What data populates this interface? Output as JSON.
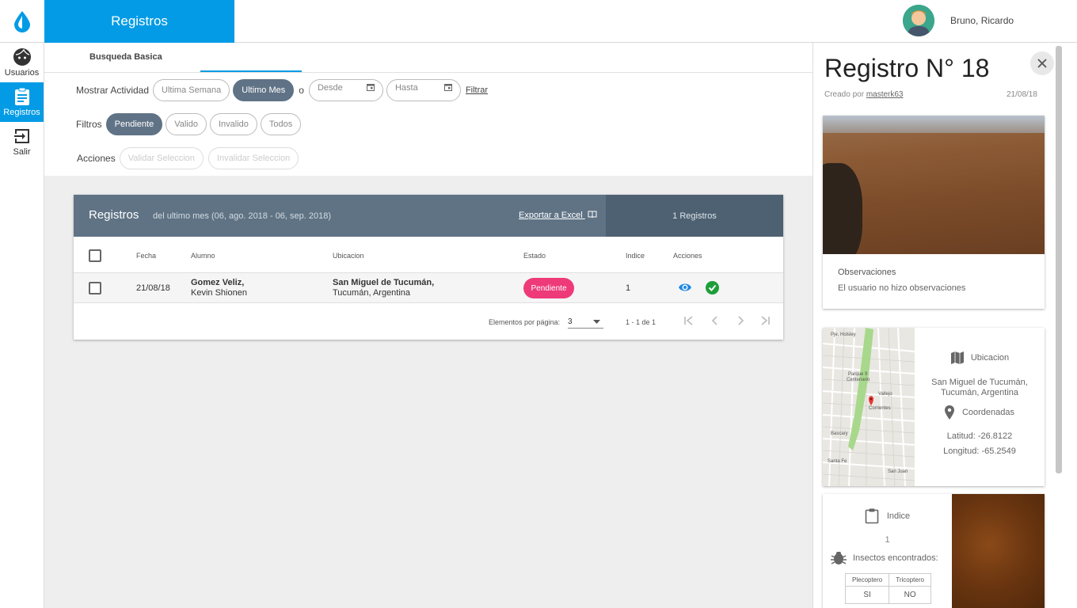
{
  "header": {
    "title": "Registros",
    "user_name": "Bruno, Ricardo"
  },
  "sidebar": {
    "items": [
      {
        "label": "Usuarios",
        "icon": "face-icon"
      },
      {
        "label": "Registros",
        "icon": "clipboard-icon",
        "active": true
      },
      {
        "label": "Salir",
        "icon": "exit-icon"
      }
    ]
  },
  "search": {
    "tab": "Busqueda Basica",
    "show_label": "Mostrar Actividad",
    "week": "Ultima Semana",
    "month": "Ultimo Mes",
    "or": "o",
    "from_placeholder": "Desde",
    "to_placeholder": "Hasta",
    "filter_link": "Filtrar",
    "filters_label": "Filtros",
    "filters": [
      "Pendiente",
      "Valido",
      "Invalido",
      "Todos"
    ],
    "actions_label": "Acciones",
    "validate": "Validar Seleccion",
    "invalidate": "Invalidar Seleccion"
  },
  "table": {
    "title": "Registros",
    "subtitle": "del ultimo mes (06, ago. 2018 - 06, sep. 2018)",
    "export": "Exportar a Excel",
    "count": "1 Registros",
    "columns": [
      "Fecha",
      "Alumno",
      "Ubicacion",
      "Estado",
      "Indice",
      "Acciones"
    ],
    "rows": [
      {
        "date": "21/08/18",
        "student_last": "Gomez Veliz,",
        "student_first": "Kevin Shionen",
        "city": "San Miguel de Tucumán,",
        "region": "Tucumán, Argentina",
        "status": "Pendiente",
        "index": "1"
      }
    ],
    "per_page_label": "Elementos por página:",
    "per_page": "3",
    "range": "1 - 1 de 1"
  },
  "detail": {
    "title": "Registro N° 18",
    "created_by_label": "Creado por",
    "creator": "masterk63",
    "date": "21/08/18",
    "obs_label": "Observaciones",
    "obs_text": "El usuario no hizo observaciones",
    "location_label": "Ubicacion",
    "location_city": "San Miguel de Tucumán,",
    "location_region": "Tucumán, Argentina",
    "coords_label": "Coordenadas",
    "lat": "Latitud: -26.8122",
    "lng": "Longitud: -65.2549",
    "map_labels": [
      "Parque 9",
      "Centenario",
      "Corrientes",
      "Bascary",
      "Vallejo",
      "Pje. Holsley",
      "San Juan",
      "Santa Fe"
    ],
    "index_label": "Indice",
    "index_value": "1",
    "insects_label": "Insectos encontrados:",
    "insect_headers": [
      "Plecoptero",
      "Tricoptero"
    ],
    "insect_values": [
      "SI",
      "NO"
    ]
  },
  "colors": {
    "primary": "#039be5",
    "header_slate": "#5f7385",
    "pending": "#ee3a79",
    "valid": "#1e9e3b"
  }
}
